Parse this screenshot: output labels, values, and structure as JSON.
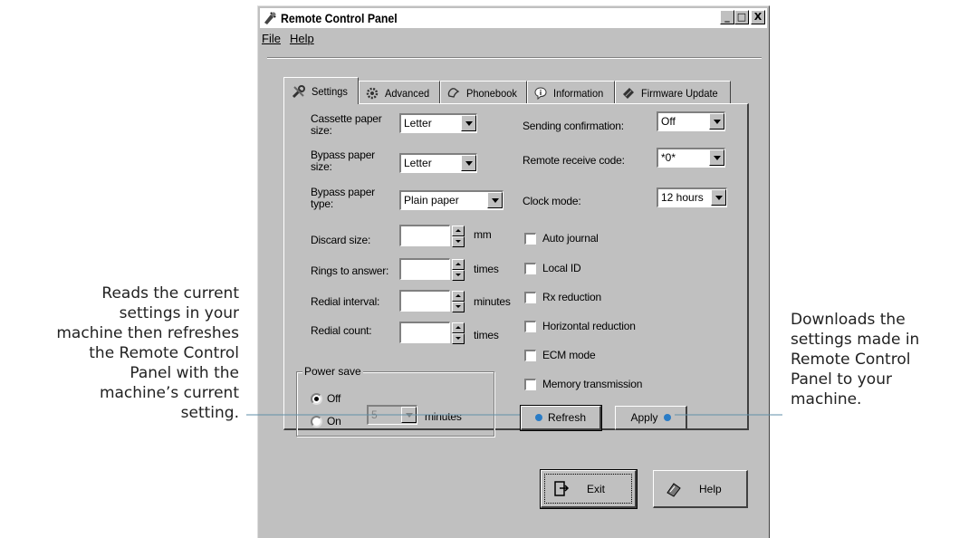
{
  "window": {
    "title": "Remote Control Panel",
    "minimize": "_",
    "maximize": "□",
    "close": "X"
  },
  "menu": {
    "file": "File",
    "help": "Help"
  },
  "tabs": [
    {
      "label": "Settings",
      "icon": "tools-icon"
    },
    {
      "label": "Advanced",
      "icon": "gear-icon"
    },
    {
      "label": "Phonebook",
      "icon": "phonebook-icon"
    },
    {
      "label": "Information",
      "icon": "info-icon"
    },
    {
      "label": "Firmware Update",
      "icon": "chip-icon"
    }
  ],
  "left": {
    "cassette_label": "Cassette paper\nsize:",
    "cassette_value": "Letter",
    "bypass_size_label": "Bypass paper\nsize:",
    "bypass_size_value": "Letter",
    "bypass_type_label": "Bypass paper\ntype:",
    "bypass_type_value": "Plain paper",
    "discard_label": "Discard size:",
    "discard_unit": "mm",
    "rings_label": "Rings to answer:",
    "rings_unit": "times",
    "redial_interval_label": "Redial interval:",
    "redial_interval_unit": "minutes",
    "redial_count_label": "Redial count:",
    "redial_count_unit": "times",
    "power_save_label": "Power save",
    "power_off": "Off",
    "power_on": "On",
    "power_minutes_value": "5",
    "power_minutes_unit": "minutes"
  },
  "right": {
    "sending_label": "Sending confirmation:",
    "sending_value": "Off",
    "remote_label": "Remote receive code:",
    "remote_value": "*0*",
    "clock_label": "Clock mode:",
    "clock_value": "12 hours",
    "checkboxes": [
      "Auto journal",
      "Local ID",
      "Rx reduction",
      "Horizontal reduction",
      "ECM mode",
      "Memory transmission"
    ]
  },
  "buttons": {
    "refresh": "Refresh",
    "apply": "Apply",
    "exit": "Exit",
    "help": "Help"
  },
  "callouts": {
    "left": "Reads the current settings in your machine then refreshes the Remote Control Panel with the machine’s current setting.",
    "right": "Downloads the settings made in Remote Control Panel to your machine."
  },
  "colors": {
    "callout_dot": "#2a7cc6",
    "leader_line": "#5f8fa8"
  }
}
